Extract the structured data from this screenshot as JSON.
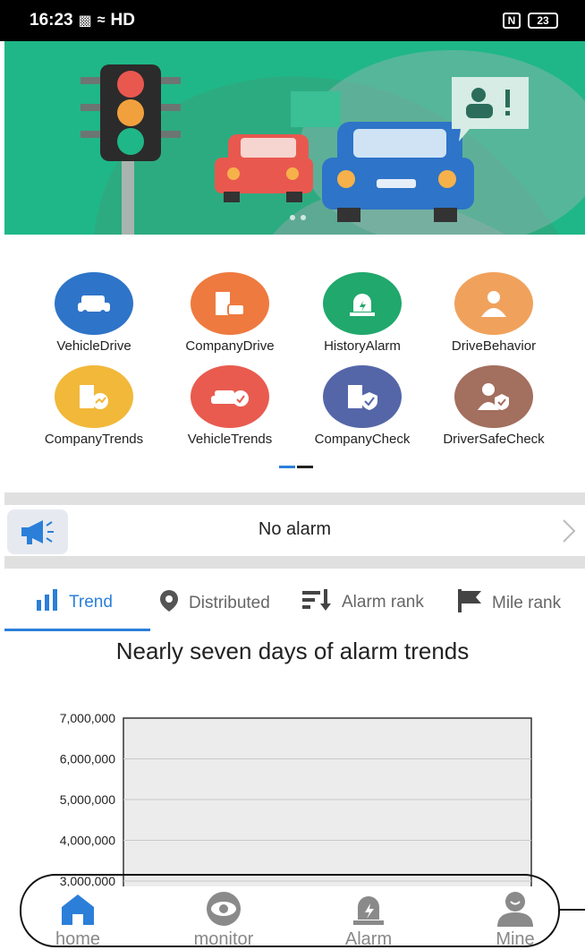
{
  "status_bar": {
    "time": "16:23",
    "network": "HD",
    "battery": "23"
  },
  "functions": [
    {
      "label": "VehicleDrive",
      "color": "#2e74c8",
      "icon": "car-icon"
    },
    {
      "label": "CompanyDrive",
      "color": "#ee7a3f",
      "icon": "building-car-icon"
    },
    {
      "label": "HistoryAlarm",
      "color": "#21a86c",
      "icon": "alarm-light-icon"
    },
    {
      "label": "DriveBehavior",
      "color": "#f0a25c",
      "icon": "driver-icon"
    },
    {
      "label": "CompanyTrends",
      "color": "#f1b83a",
      "icon": "building-trend-icon"
    },
    {
      "label": "VehicleTrends",
      "color": "#e95b4f",
      "icon": "car-trend-icon"
    },
    {
      "label": "CompanyCheck",
      "color": "#5566a8",
      "icon": "building-shield-icon"
    },
    {
      "label": "DriverSafeCheck",
      "color": "#a36f5e",
      "icon": "person-shield-icon"
    }
  ],
  "alarm": {
    "text": "No alarm"
  },
  "tabs": [
    {
      "label": "Trend",
      "icon": "bar-chart-icon",
      "active": true
    },
    {
      "label": "Distributed",
      "icon": "location-pin-icon",
      "active": false
    },
    {
      "label": "Alarm rank",
      "icon": "sort-rank-icon",
      "active": false
    },
    {
      "label": "Mile rank",
      "icon": "flag-icon",
      "active": false
    }
  ],
  "chart_title": "Nearly seven days of alarm trends",
  "chart_data": {
    "type": "line",
    "title": "Nearly seven days of alarm trends",
    "y_ticks": [
      "7,000,000",
      "6,000,000",
      "5,000,000",
      "4,000,000",
      "3,000,000"
    ],
    "ylim": [
      3000000,
      7000000
    ],
    "grid": true
  },
  "bottom_nav": [
    {
      "label": "home",
      "icon": "home-icon",
      "active": true
    },
    {
      "label": "monitor",
      "icon": "eye-icon",
      "active": false
    },
    {
      "label": "Alarm",
      "icon": "alarm-light-icon",
      "active": false
    },
    {
      "label": "Mine",
      "icon": "user-icon",
      "active": false
    }
  ],
  "colors": {
    "accent": "#2b7fd9",
    "banner": "#1fb787"
  }
}
